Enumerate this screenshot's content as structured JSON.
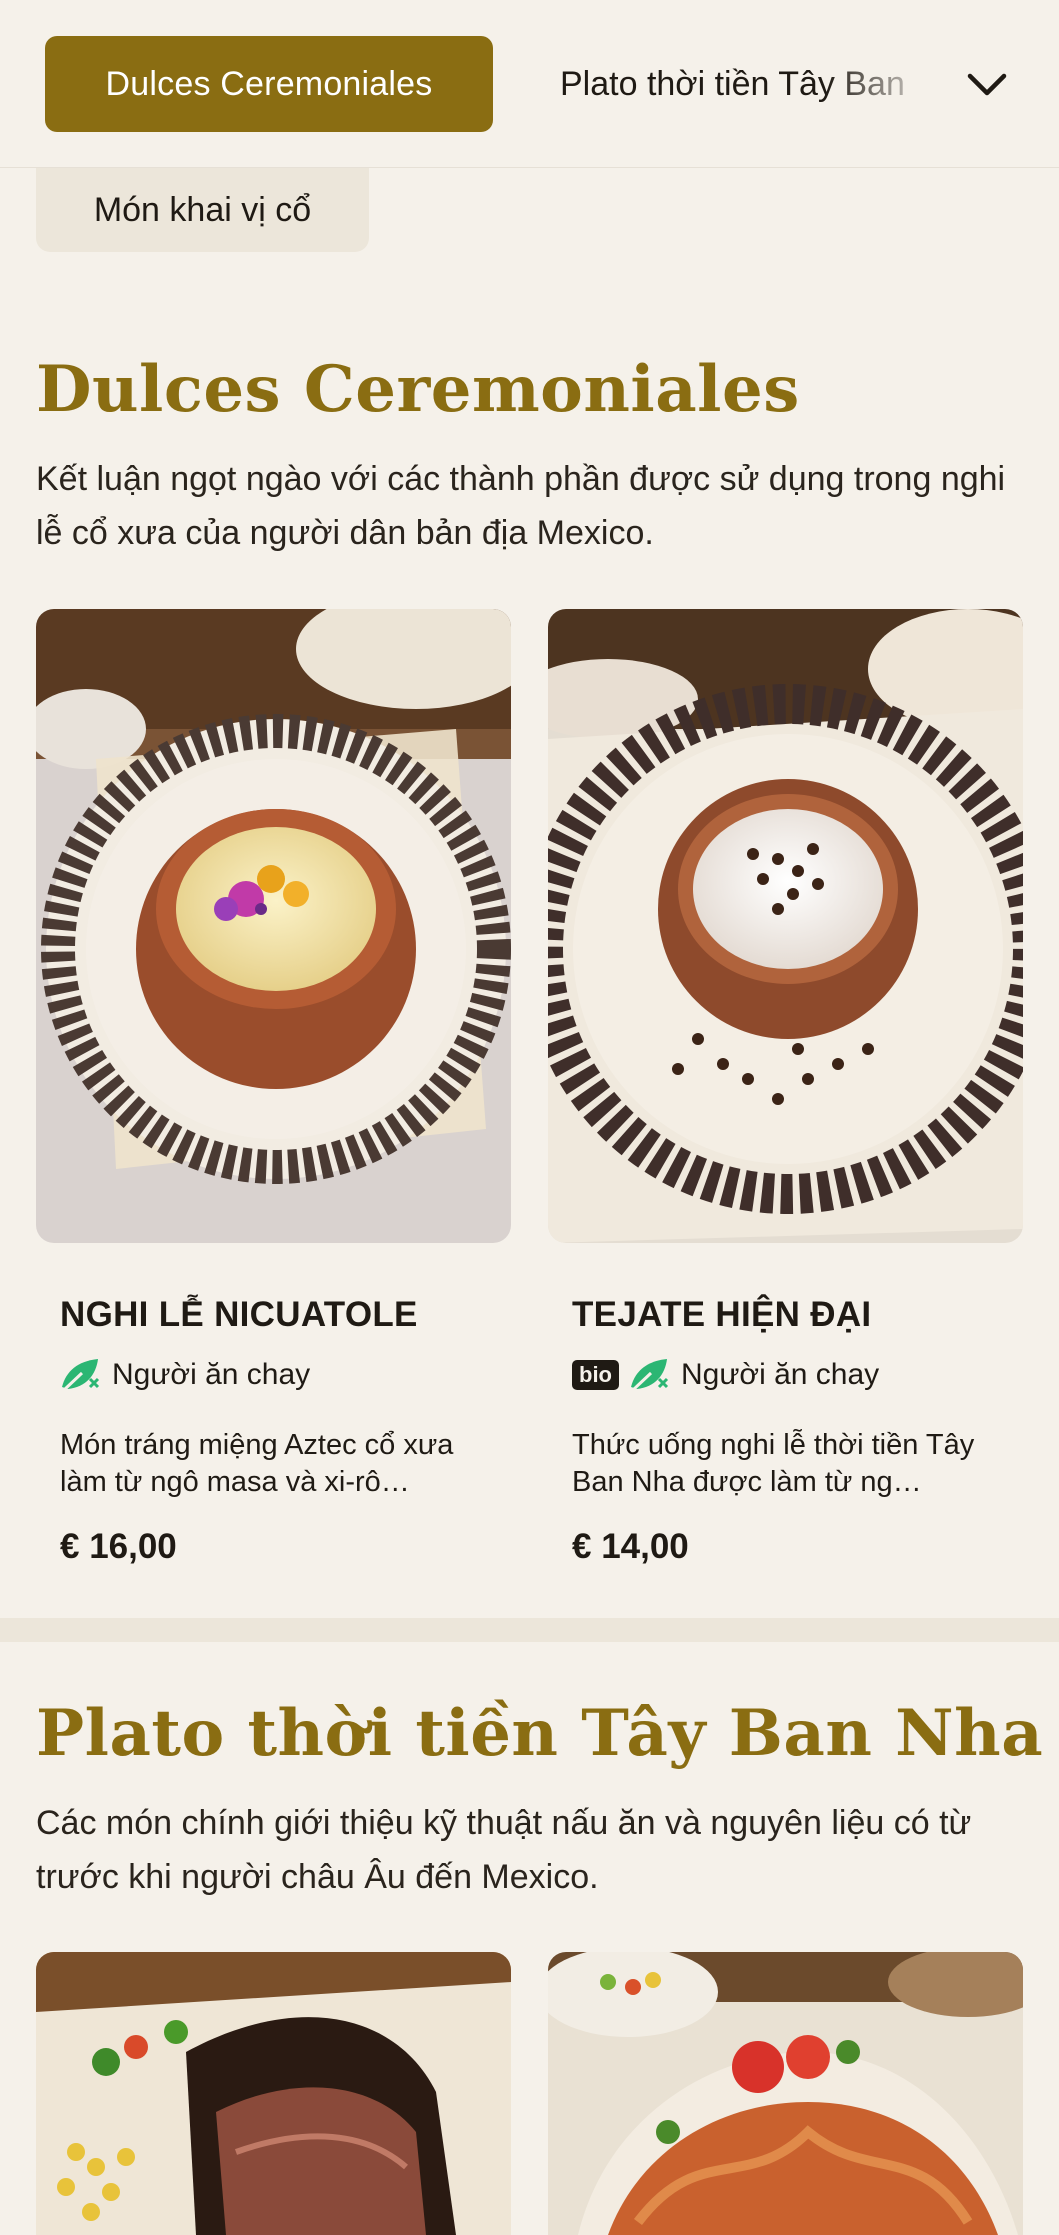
{
  "nav": {
    "active_category": "Dulces Ceremoniales",
    "next_category": "Plato thời tiền Tây Ban",
    "chip_category": "Món khai vị cổ",
    "chevron_icon": "chevron-down-icon"
  },
  "sections": [
    {
      "title": "Dulces Ceremoniales",
      "description": "Kết luận ngọt ngào với các thành phần được sử dụng trong nghi lễ cổ xưa của người dân bản địa Mexico.",
      "items": [
        {
          "name": "NGHI LỄ NICUATOLE",
          "tags": {
            "bio": "",
            "diet": "Người ăn chay"
          },
          "description": "Món tráng miệng Aztec cổ xưa làm từ ngô masa và xi-rô…",
          "price": "€ 16,00"
        },
        {
          "name": "TEJATE HIỆN ĐẠI",
          "tags": {
            "bio": "bio",
            "diet": "Người ăn chay"
          },
          "description": "Thức uống nghi lễ thời tiền Tây Ban Nha được làm từ ng…",
          "price": "€ 14,00"
        }
      ]
    },
    {
      "title": "Plato thời tiền Tây Ban Nha",
      "description": "Các món chính giới thiệu kỹ thuật nấu ăn và nguyên liệu có từ trước khi người châu Âu đến Mexico."
    }
  ],
  "colors": {
    "accent": "#8a6d12",
    "background": "#f5f1ea",
    "vegetarian_icon": "#2bb673"
  }
}
